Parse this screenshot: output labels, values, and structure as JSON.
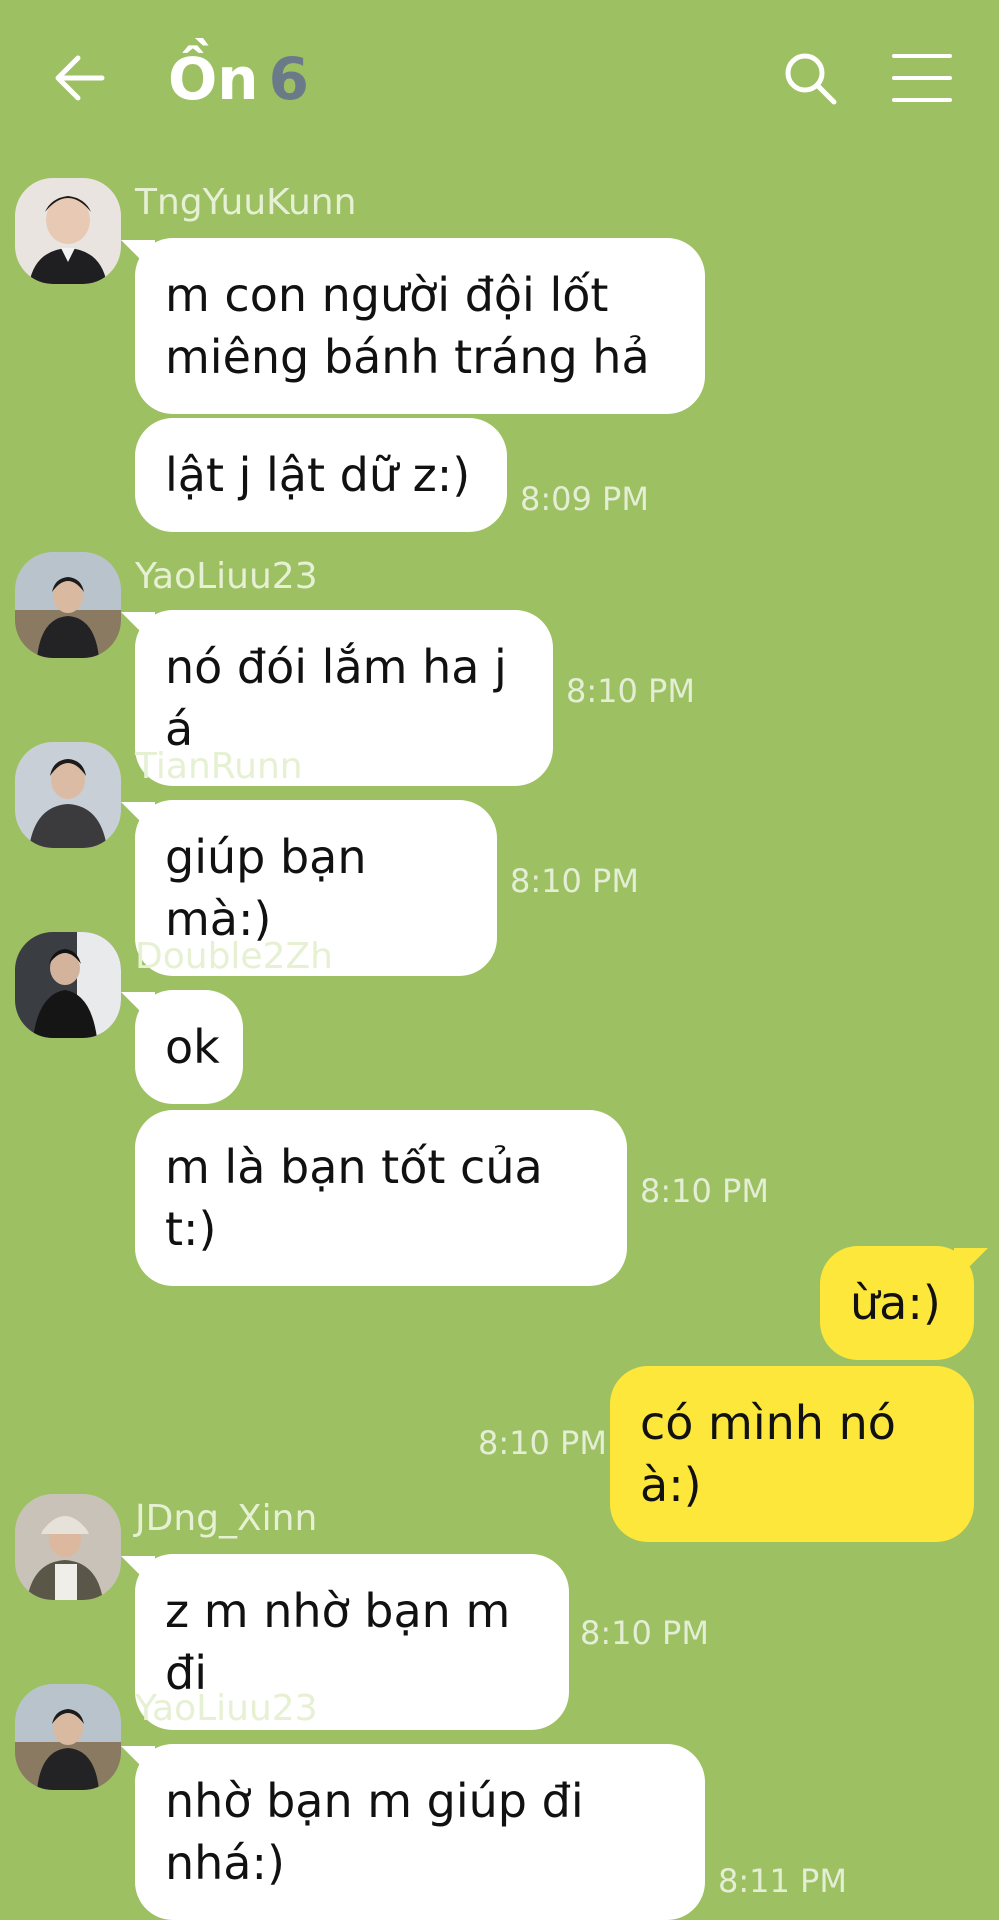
{
  "header": {
    "title": "Ồn",
    "member_count": "6",
    "colors": {
      "background": "#9cc062",
      "my_bubble": "#fde73a",
      "other_bubble": "#ffffff"
    }
  },
  "messages": [
    {
      "sender": "TngYuuKunn",
      "text_lines": [
        "m con người đội lốt",
        "miêng bánh tráng hả"
      ]
    },
    {
      "text": "lật j lật dữ z:)",
      "time": "8:09 PM"
    },
    {
      "sender": "YaoLiuu23",
      "text": "nó đói lắm ha j á",
      "time": "8:10 PM"
    },
    {
      "sender": "TianRunn",
      "text": "giúp bạn mà:)",
      "time": "8:10 PM"
    },
    {
      "sender": "Double2Zh",
      "text": "ok"
    },
    {
      "text": "m là bạn tốt của t:)",
      "time": "8:10 PM"
    },
    {
      "mine": true,
      "text": "ừa:)"
    },
    {
      "mine": true,
      "text": "có mình nó à:)",
      "time": "8:10 PM"
    },
    {
      "sender": "JDng_Xinn",
      "text": "z m nhờ bạn m đi",
      "time": "8:10 PM"
    },
    {
      "sender": "YaoLiuu23",
      "text_lines": [
        "nhờ bạn m giúp đi",
        "nhá:)"
      ],
      "time": "8:11 PM"
    }
  ]
}
